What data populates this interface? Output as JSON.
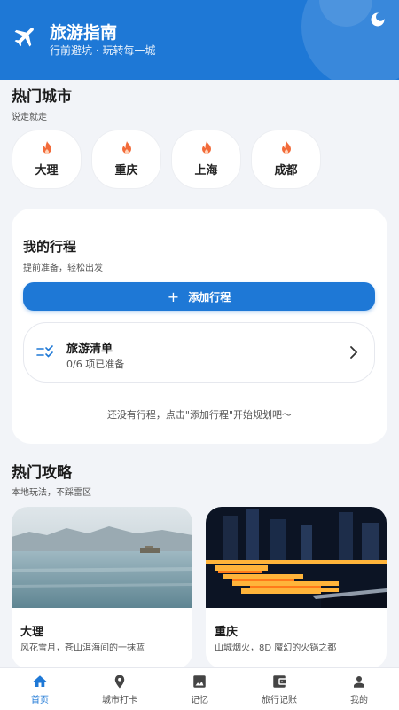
{
  "header": {
    "title": "旅游指南",
    "subtitle": "行前避坑 · 玩转每一城",
    "plane_icon": "airplane-icon",
    "theme_icon": "moon-icon",
    "bg_color": "#1e78d6"
  },
  "hot_cities": {
    "title": "热门城市",
    "subtitle": "说走就走",
    "items": [
      {
        "name": "大理",
        "icon": "fire-icon"
      },
      {
        "name": "重庆",
        "icon": "fire-icon"
      },
      {
        "name": "上海",
        "icon": "fire-icon"
      },
      {
        "name": "成都",
        "icon": "fire-icon"
      }
    ]
  },
  "trips": {
    "title": "我的行程",
    "subtitle": "提前准备，轻松出发",
    "add_button": "添加行程",
    "checklist": {
      "title": "旅游清单",
      "status": "0/6 项已准备"
    },
    "empty_text": "还没有行程，点击\"添加行程\"开始规划吧～"
  },
  "guides": {
    "title": "热门攻略",
    "subtitle": "本地玩法，不踩雷区",
    "items": [
      {
        "name": "大理",
        "desc": "风花雪月，苍山洱海间的一抹蓝"
      },
      {
        "name": "重庆",
        "desc": "山城烟火，8D 魔幻的火锅之都"
      }
    ]
  },
  "nav": {
    "items": [
      {
        "label": "首页",
        "icon": "home-icon",
        "active": true
      },
      {
        "label": "城市打卡",
        "icon": "location-pin-icon",
        "active": false
      },
      {
        "label": "记忆",
        "icon": "photo-icon",
        "active": false
      },
      {
        "label": "旅行记账",
        "icon": "wallet-icon",
        "active": false
      },
      {
        "label": "我的",
        "icon": "user-icon",
        "active": false
      }
    ]
  }
}
